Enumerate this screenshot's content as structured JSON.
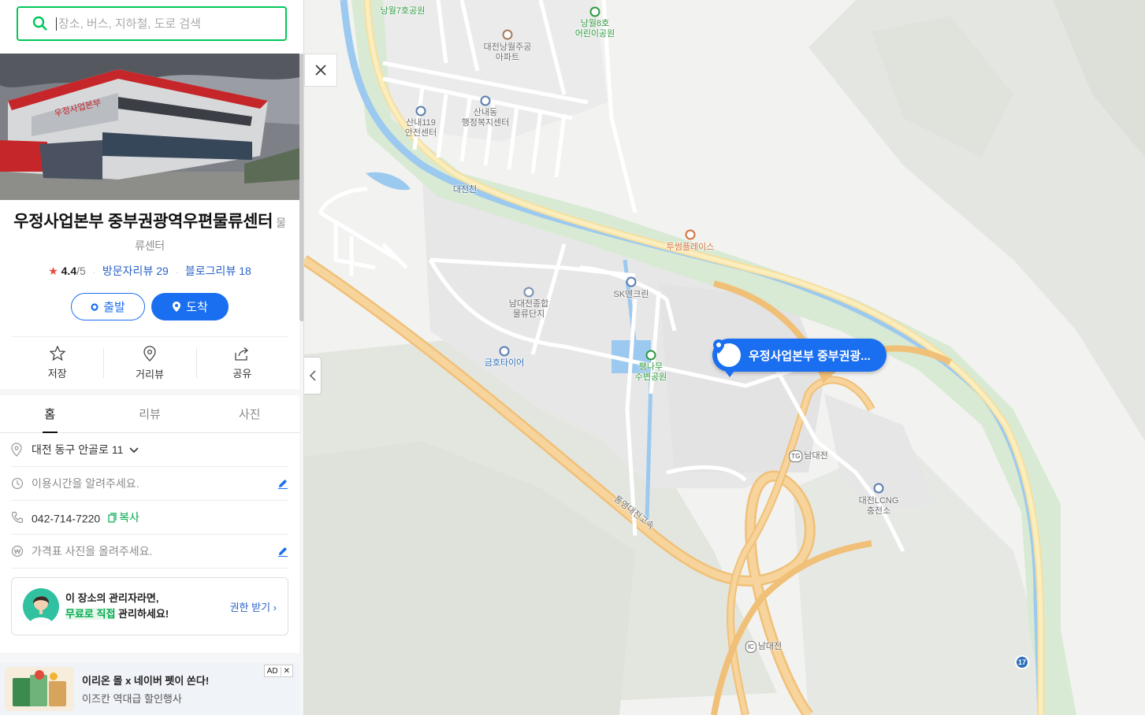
{
  "search": {
    "placeholder": "장소, 버스, 지하철, 도로 검색"
  },
  "place": {
    "name": "우정사업본부 중부권광역우편물류센터",
    "category": "물류센터",
    "rating": "4.4",
    "rating_max": "/5",
    "visitor_reviews": "방문자리뷰 29",
    "blog_reviews": "블로그리뷰 18"
  },
  "route_buttons": {
    "start": "출발",
    "arrive": "도착"
  },
  "actions": {
    "save": "저장",
    "street_view": "거리뷰",
    "share": "공유"
  },
  "tabs": [
    {
      "label": "홈",
      "active": true
    },
    {
      "label": "리뷰",
      "active": false
    },
    {
      "label": "사진",
      "active": false
    }
  ],
  "details": {
    "address": "대전 동구 안골로 11",
    "hours_prompt": "이용시간을 알려주세요.",
    "phone": "042-714-7220",
    "copy_label": "복사",
    "price_prompt": "가격표 사진을 올려주세요."
  },
  "owner_card": {
    "line1": "이 장소의 관리자라면,",
    "line2_highlight": "무료로 직접",
    "line2_rest": " 관리하세요!",
    "link": "권한 받기 ›"
  },
  "ad": {
    "title": "이리온 몰 x 네이버 펫이 쏜다!",
    "subtitle": "이즈칸 역대급 할인행사",
    "badge": "AD",
    "close": "✕"
  },
  "map": {
    "pin_label": "우정사업본부 중부권광...",
    "route_number": "17",
    "labels": {
      "park7": "낭월7호공원",
      "park8": "낭월8호\n어린이공원",
      "apt": "대전낭월주공\n아파트",
      "fire": "산내119\n안전센터",
      "office": "산내동\n행정복지센터",
      "river": "대전천",
      "twosome": "투썸플레이스",
      "logistics": "남대전종합\n물류단지",
      "sk": "SK엔크린",
      "kumho": "금호타이어",
      "pengnamu": "팽나무\n수변공원",
      "tg": "남대전",
      "lcng": "대전LCNG\n충전소",
      "expressway": "통영대전고속",
      "ic": "남대전",
      "tg_badge": "TG",
      "ic_badge": "IC"
    }
  },
  "colors": {
    "brand_green": "#03c75a",
    "primary_blue": "#1a6ef0",
    "road_orange": "#f5c078",
    "river_blue": "#9cc9ef"
  }
}
